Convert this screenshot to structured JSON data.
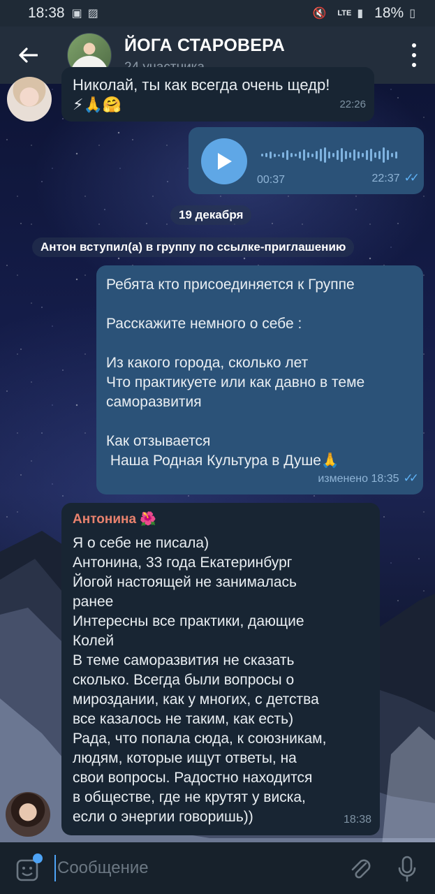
{
  "status_bar": {
    "time": "18:38",
    "network": "LTE",
    "battery": "18%"
  },
  "header": {
    "title": "ЙОГА СТАРОВЕРА",
    "subtitle": "24 участника"
  },
  "messages": {
    "m1": {
      "text_top": "Николай, ты как всегда очень щедр!",
      "emoji": "⚡🙏🤗",
      "time": "22:26"
    },
    "voice": {
      "duration": "00:37",
      "time": "22:37"
    },
    "date_separator": "19 декабря",
    "service": "Антон вступил(а) в группу по ссылке-приглашению",
    "m3": {
      "line1": "Ребята кто присоединяется к Группе",
      "line2": "Расскажите немного о себе :",
      "line3": "Из какого города, сколько лет",
      "line4": "Что практикуете или как давно в теме саморазвития",
      "line5": "Как отзывается",
      "line6": " Наша Родная Культура в Душе🙏",
      "edited": "изменено",
      "time": "18:35"
    },
    "m4": {
      "sender": "Антонина 🌺",
      "lines": [
        "Я о себе не писала)",
        "Антонина, 33 года Екатеринбург",
        "Йогой настоящей не занималась",
        "ранее",
        "Интересны все практики, дающие",
        "Колей",
        "В теме саморазвития не сказать",
        "сколько. Всегда были вопросы о",
        "мироздании, как у многих, с детства",
        "все казалось не таким, как есть)",
        "Рада, что попала сюда, к союзникам,",
        "людям, которые ищут ответы, на",
        "свои вопросы. Радостно находится",
        "в обществе, где не крутят у виска,",
        "если о энергии говоришь))"
      ],
      "time": "18:38"
    }
  },
  "input": {
    "placeholder": "Сообщение"
  },
  "colors": {
    "header_bg": "#232e3c",
    "incoming_bubble": "#182533",
    "outgoing_bubble": "#2b5278",
    "accent": "#5fa7e6",
    "sender_name": "#e9826e"
  }
}
